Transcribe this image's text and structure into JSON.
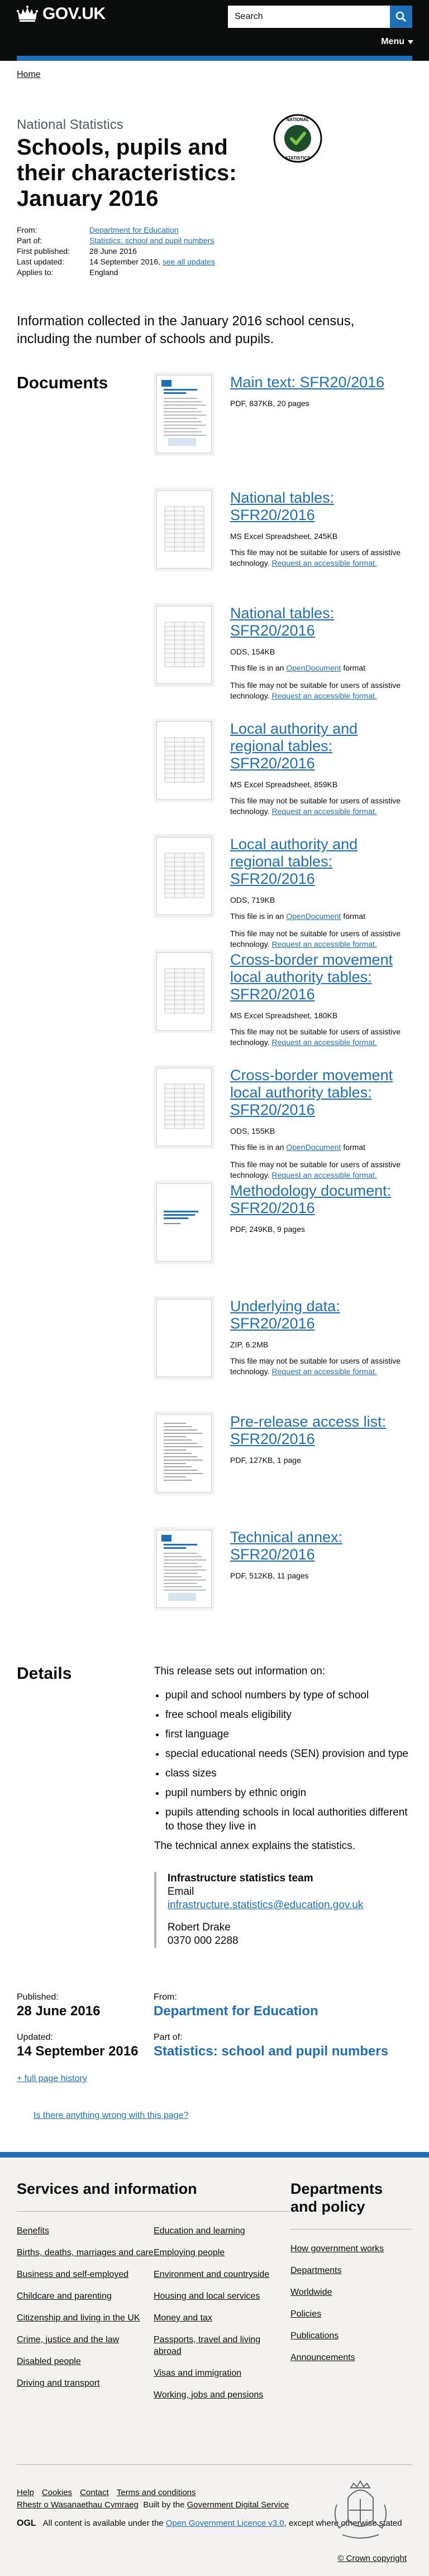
{
  "header": {
    "logo_text": "GOV.UK",
    "search_placeholder": "Search",
    "menu_label": "Menu",
    "colors": {
      "header_bg": "#0b0c0c",
      "accent": "#1d70b8"
    }
  },
  "breadcrumb": {
    "home": "Home"
  },
  "page": {
    "context": "National Statistics",
    "title": "Schools, pupils and their characteristics: January 2016",
    "badge_text": "NATIONAL STATISTICS"
  },
  "metadata": {
    "from_label": "From:",
    "from_value": "Department for Education",
    "partof_label": "Part of:",
    "partof_value": "Statistics: school and pupil numbers",
    "first_published_label": "First published:",
    "first_published_value": "28 June 2016",
    "last_updated_label": "Last updated:",
    "last_updated_value": "14 September 2016,",
    "see_all_updates": "see all updates",
    "applies_label": "Applies to:",
    "applies_value": "England"
  },
  "lead": "Information collected in the January 2016 school census, including the number of schools and pupils.",
  "documents": {
    "heading": "Documents",
    "items": [
      {
        "title": "Main text: SFR20/2016",
        "meta": "PDF, 837KB, 20 pages",
        "format": "",
        "note": "",
        "note_link": "",
        "thumb": "pdf"
      },
      {
        "title": "National tables: SFR20/2016",
        "meta": "MS Excel Spreadsheet, 245KB",
        "format": "",
        "note": "This file may not be suitable for users of assistive technology.",
        "note_link": "Request an accessible format.",
        "thumb": "sheet"
      },
      {
        "title": "National tables: SFR20/2016",
        "meta": "ODS, 154KB",
        "format_prefix": "This file is in an",
        "format_link": "OpenDocument",
        "format_suffix": "format",
        "note": "This file may not be suitable for users of assistive technology.",
        "note_link": "Request an accessible format.",
        "thumb": "sheet"
      },
      {
        "title": "Local authority and regional tables: SFR20/2016",
        "meta": "MS Excel Spreadsheet, 859KB",
        "format": "",
        "note": "This file may not be suitable for users of assistive technology.",
        "note_link": "Request an accessible format.",
        "thumb": "sheet"
      },
      {
        "title": "Local authority and regional tables: SFR20/2016",
        "meta": "ODS, 719KB",
        "format_prefix": "This file is in an",
        "format_link": "OpenDocument",
        "format_suffix": "format",
        "note": "This file may not be suitable for users of assistive technology.",
        "note_link": "Request an accessible format.",
        "thumb": "sheet"
      },
      {
        "title": "Cross-border movement local authority tables: SFR20/2016",
        "meta": "MS Excel Spreadsheet, 180KB",
        "format": "",
        "note": "This file may not be suitable for users of assistive technology.",
        "note_link": "Request an accessible format.",
        "thumb": "sheet"
      },
      {
        "title": "Cross-border movement local authority tables: SFR20/2016",
        "meta": "ODS, 155KB",
        "format_prefix": "This file is in an",
        "format_link": "OpenDocument",
        "format_suffix": "format",
        "note": "This file may not be suitable for users of assistive technology.",
        "note_link": "Request an accessible format.",
        "thumb": "sheet"
      },
      {
        "title": "Methodology document: SFR20/2016",
        "meta": "PDF, 249KB, 9 pages",
        "format": "",
        "note": "",
        "note_link": "",
        "thumb": "method"
      },
      {
        "title": "Underlying data: SFR20/2016",
        "meta": "ZIP, 6.2MB",
        "format": "",
        "note": "This file may not be suitable for users of assistive technology.",
        "note_link": "Request an accessible format.",
        "thumb": "blank"
      },
      {
        "title": "Pre-release access list: SFR20/2016",
        "meta": "PDF, 127KB, 1 page",
        "format": "",
        "note": "",
        "note_link": "",
        "thumb": "list"
      },
      {
        "title": "Technical annex: SFR20/2016",
        "meta": "PDF, 512KB, 11 pages",
        "format": "",
        "note": "",
        "note_link": "",
        "thumb": "pdf"
      }
    ]
  },
  "details": {
    "heading": "Details",
    "intro": "This release sets out information on:",
    "bullets": [
      "pupil and school numbers by type of school",
      "free school meals eligibility",
      "first language",
      "special educational needs (SEN) provision and type",
      "class sizes",
      "pupil numbers by ethnic origin",
      "pupils attending schools in local authorities different to those they live in"
    ],
    "outro": "The technical annex explains the statistics.",
    "contact_team": "Infrastructure statistics team",
    "email_label": "Email",
    "email": "infrastructure.statistics@education.gov.uk",
    "contact_name": "Robert Drake",
    "contact_phone": "0370 000 2288"
  },
  "publication": {
    "published_label": "Published:",
    "published_value": "28 June 2016",
    "from_label": "From:",
    "from_value": "Department for Education",
    "updated_label": "Updated:",
    "updated_value": "14 September 2016",
    "partof_label": "Part of:",
    "partof_value": "Statistics: school and pupil numbers",
    "history_link": "+ full page history",
    "report_link": "Is there anything wrong with this page?"
  },
  "footer": {
    "services_heading": "Services and information",
    "services_col1": [
      "Benefits",
      "Births, deaths, marriages and care",
      "Business and self-employed",
      "Childcare and parenting",
      "Citizenship and living in the UK",
      "Crime, justice and the law",
      "Disabled people",
      "Driving and transport"
    ],
    "services_col2": [
      "Education and learning",
      "Employing people",
      "Environment and countryside",
      "Housing and local services",
      "Money and tax",
      "Passports, travel and living abroad",
      "Visas and immigration",
      "Working, jobs and pensions"
    ],
    "depts_heading": "Departments and policy",
    "depts": [
      "How government works",
      "Departments",
      "Worldwide",
      "Policies",
      "Publications",
      "Announcements"
    ],
    "links": [
      "Help",
      "Cookies",
      "Contact",
      "Terms and conditions"
    ],
    "welsh_link": "Rhestr o Wasanaethau Cymraeg",
    "built_by_prefix": "Built by the",
    "built_by_link": "Government Digital Service",
    "ogl_label": "OGL",
    "licence_prefix": "All content is available under the",
    "licence_link": "Open Government Licence v3.0",
    "licence_suffix": ", except where otherwise stated",
    "copyright": "© Crown copyright"
  }
}
